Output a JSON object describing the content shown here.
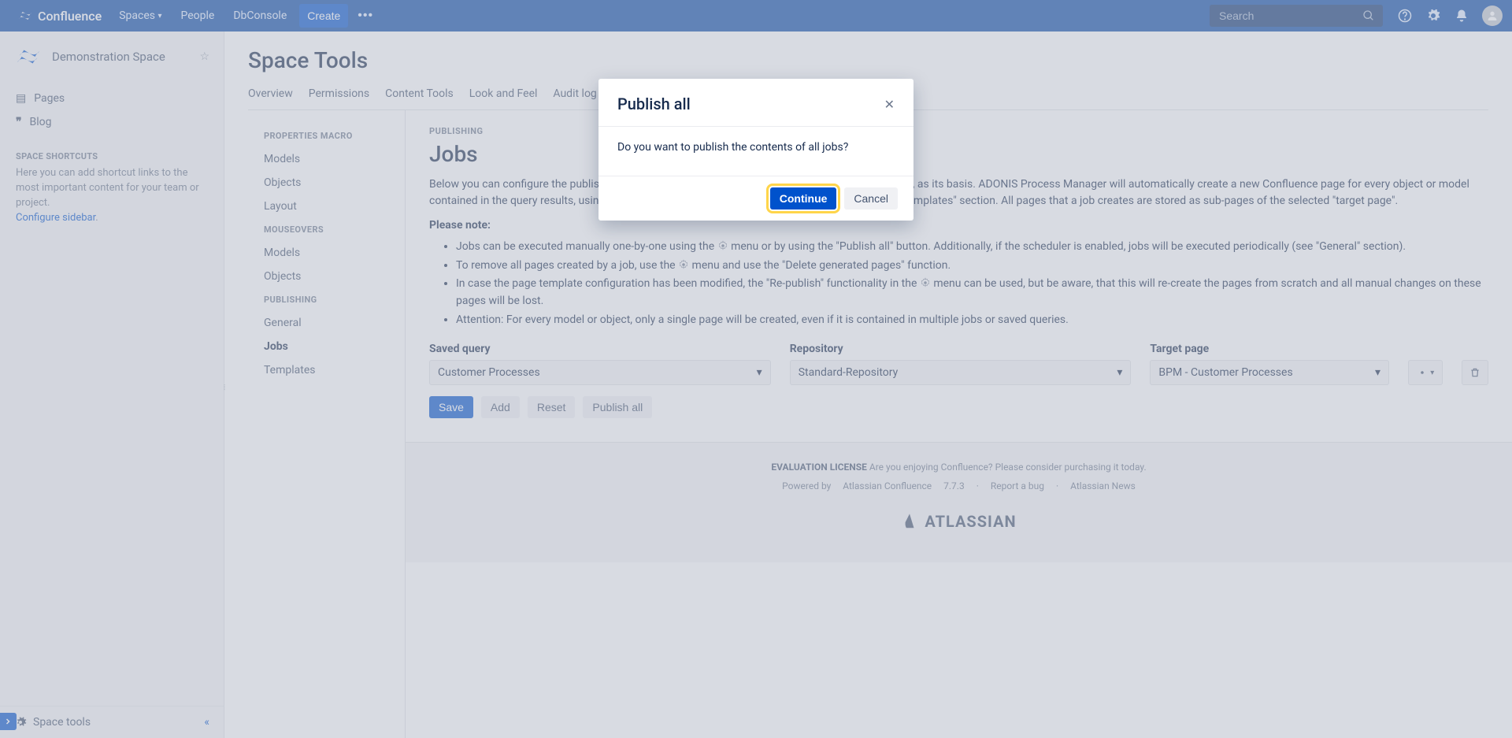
{
  "topbar": {
    "product": "Confluence",
    "nav": {
      "spaces": "Spaces",
      "people": "People",
      "dbconsole": "DbConsole"
    },
    "create": "Create",
    "search_placeholder": "Search"
  },
  "sidebar": {
    "space_name": "Demonstration Space",
    "pages": "Pages",
    "blog": "Blog",
    "shortcuts_heading": "SPACE SHORTCUTS",
    "shortcuts_hint": "Here you can add shortcut links to the most important content for your team or project.",
    "configure": "Configure sidebar",
    "bottom": "Space tools"
  },
  "main": {
    "title": "Space Tools",
    "tabs": {
      "overview": "Overview",
      "permissions": "Permissions",
      "contenttools": "Content Tools",
      "lookfeel": "Look and Feel",
      "auditlog": "Audit log"
    }
  },
  "contentside": {
    "g1": "PROPERTIES MACRO",
    "g1_models": "Models",
    "g1_objects": "Objects",
    "g1_layout": "Layout",
    "g2": "MOUSEOVERS",
    "g2_models": "Models",
    "g2_objects": "Objects",
    "g3": "PUBLISHING",
    "g3_general": "General",
    "g3_jobs": "Jobs",
    "g3_templates": "Templates"
  },
  "body": {
    "section": "PUBLISHING",
    "heading": "Jobs",
    "para": "Below you can configure the publishing jobs. Each job uses a saved query, as configured in ADONIS, as its basis. ADONIS Process Manager will automatically create a new Confluence page for every object or model contained in the query results, using one of the page templates that have been configured in the \"Templates\" section. All pages that a job creates are stored as sub-pages of the selected \"target page\".",
    "note_label": "Please note:",
    "note1a": "Jobs can be executed manually one-by-one using the ",
    "note1b": " menu or by using the \"Publish all\" button. Additionally, if the scheduler is enabled, jobs will be executed periodically (see \"General\" section).",
    "note2a": "To remove all pages created by a job, use the ",
    "note2b": " menu and use the \"Delete generated pages\" function.",
    "note3a": "In case the page template configuration has been modified, the \"Re-publish\" functionality in the ",
    "note3b": " menu can be used, but be aware, that this will re-create the pages from scratch and all manual changes on these pages will be lost.",
    "note4": "Attention: For every model or object, only a single page will be created, even if it is contained in multiple jobs or saved queries.",
    "labels": {
      "query": "Saved query",
      "repo": "Repository",
      "target": "Target page"
    },
    "values": {
      "query": "Customer Processes",
      "repo": "Standard-Repository",
      "target": "BPM - Customer Processes"
    },
    "buttons": {
      "save": "Save",
      "add": "Add",
      "reset": "Reset",
      "publishall": "Publish all"
    }
  },
  "footer": {
    "eval_bold": "EVALUATION LICENSE",
    "eval_rest": " Are you enjoying Confluence? Please consider purchasing it today.",
    "powered": "Powered by ",
    "product": "Atlassian Confluence",
    "version": " 7.7.3",
    "bug": "Report a bug",
    "news": "Atlassian News",
    "brand": "ATLASSIAN"
  },
  "modal": {
    "title": "Publish all",
    "body": "Do you want to publish the contents of all jobs?",
    "continue": "Continue",
    "cancel": "Cancel"
  }
}
